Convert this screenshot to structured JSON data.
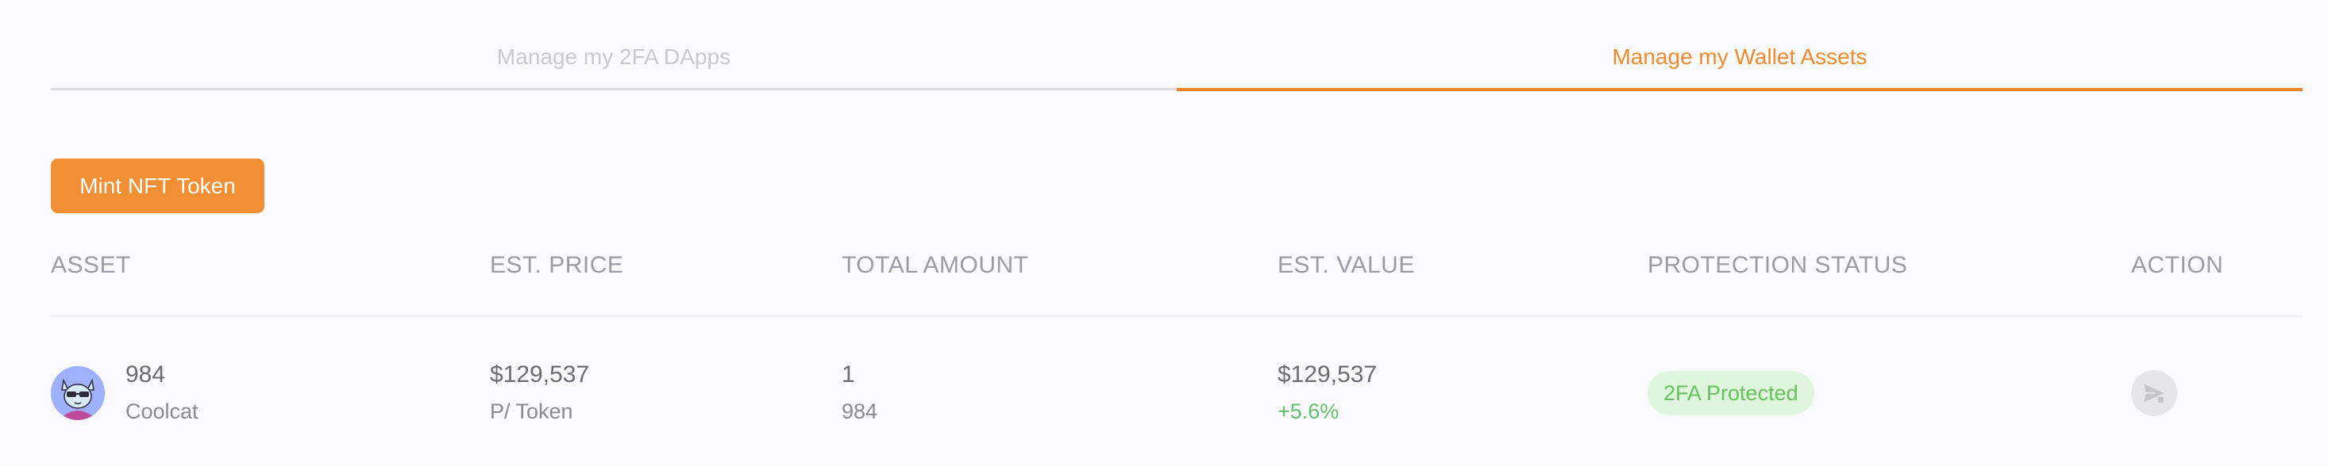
{
  "tabs": [
    {
      "label": "Manage my 2FA DApps",
      "active": false
    },
    {
      "label": "Manage my Wallet Assets",
      "active": true
    }
  ],
  "mint_button": {
    "label": "Mint NFT Token"
  },
  "table": {
    "headers": {
      "asset": "ASSET",
      "price": "EST. PRICE",
      "amount": "TOTAL AMOUNT",
      "value": "EST. VALUE",
      "status": "PROTECTION STATUS",
      "action": "ACTION"
    },
    "rows": [
      {
        "asset_id": "984",
        "asset_name": "Coolcat",
        "price": "$129,537",
        "price_unit": "P/ Token",
        "amount": "1",
        "amount_sub": "984",
        "value": "$129,537",
        "value_change": "+5.6%",
        "status": "2FA Protected",
        "action_icon": "send-icon"
      }
    ]
  },
  "colors": {
    "accent": "#f28f34",
    "positive": "#5fc26a",
    "badge_bg": "#dff5de",
    "badge_text": "#66c35b"
  }
}
